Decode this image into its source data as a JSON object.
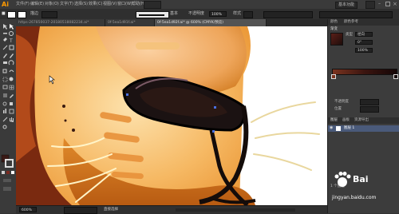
{
  "app": {
    "logo": "Ai"
  },
  "menu": [
    "文件(F)",
    "编辑(E)",
    "对象(O)",
    "文字(T)",
    "选择(S)",
    "效果(C)",
    "视图(V)",
    "窗口(W)",
    "帮助(H)"
  ],
  "workspace": "基本功能",
  "control_bar": {
    "stroke_label": "描边",
    "brush_label": "基本",
    "opacity_label": "不透明度",
    "opacity_value": "100%",
    "style_label": "样式"
  },
  "tabs": [
    {
      "label": "https-267850037-20180518082234.ai*",
      "active": false
    },
    {
      "label": "0f-5ea1d91f.ai*",
      "active": false
    },
    {
      "label": "0f-5ea1d92f.ai* @ 600% (CMYK/预览)",
      "active": true
    }
  ],
  "status": {
    "zoom": "600%",
    "mode": "直接选择"
  },
  "panels": {
    "color_tabs": [
      "颜色",
      "颜色参考"
    ],
    "gradient": {
      "title": "渐变",
      "type_label": "类型",
      "type_value": "径向",
      "angle_value": "0°",
      "ratio_value": "100%",
      "opacity_label": "不透明度",
      "position_label": "位置"
    },
    "layers_tabs": [
      "图层",
      "画板",
      "资源导出"
    ],
    "layer_name": "图层 1",
    "layers_count": "1 个图层"
  },
  "watermark": {
    "brand": "Bai",
    "site": "jingyan.baidu.com"
  },
  "colors": {
    "fur_orange": "#e58a1e",
    "fur_light": "#f7c67a",
    "nose_dark": "#1b1212",
    "gradient_brown": "#4a2016",
    "ui_dark": "#323232"
  }
}
